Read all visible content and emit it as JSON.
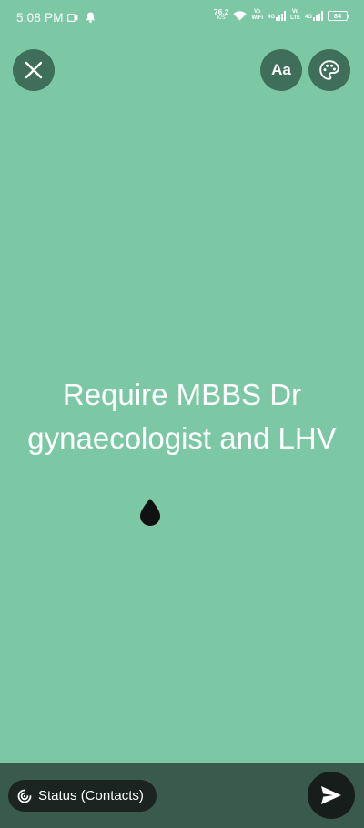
{
  "status_bar": {
    "time": "5:08 PM",
    "net_speed_value": "76.2",
    "net_speed_unit": "K/S",
    "wifi_label_top": "Vo",
    "wifi_label_bottom": "WiFi",
    "sim1_type": "4G",
    "sim2_label_top": "Vo",
    "sim2_label_bottom": "LTE",
    "sim2_type": "4G",
    "battery": "84"
  },
  "toolbar": {
    "close_icon": "close-icon",
    "font_label": "Aa",
    "palette_icon": "palette-icon"
  },
  "composer": {
    "text": "Require MBBS Dr gynaecologist and LHV",
    "background_color": "#7dc8a4"
  },
  "footer": {
    "audience_label": "Status (Contacts)",
    "send_icon": "send-icon"
  }
}
